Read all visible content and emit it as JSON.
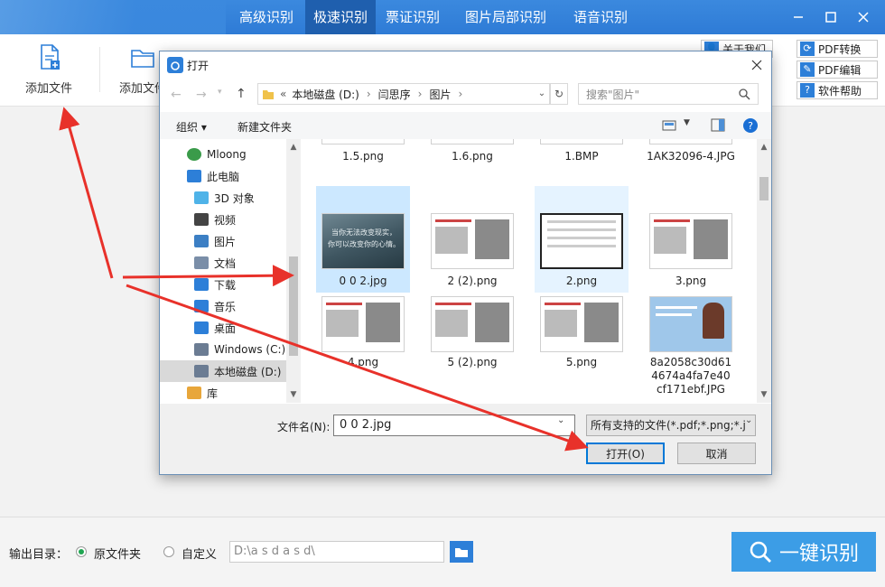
{
  "app": {
    "tabs": [
      "高级识别",
      "极速识别",
      "票证识别",
      "图片局部识别",
      "语音识别"
    ],
    "active_tab": "极速识别",
    "toolbar": {
      "add_file": "添加文件",
      "add_folder": "添加文件"
    },
    "side_buttons": {
      "about": "关于我们",
      "pdf_convert": "PDF转换",
      "pdf_edit": "PDF编辑",
      "help": "软件帮助"
    },
    "footer": {
      "output_label": "输出目录：",
      "option_original": "原文件夹",
      "option_custom": "自定义",
      "path_placeholder": "D:\\a s d a s d\\",
      "recognize_button": "一键识别"
    }
  },
  "dialog": {
    "title": "打开",
    "breadcrumb": [
      "本地磁盘 (D:)",
      "闫思序",
      "图片"
    ],
    "breadcrumb_prefix": "«",
    "search_placeholder": "搜索\"图片\"",
    "organize": "组织 ▾",
    "new_folder": "新建文件夹",
    "nav_items": [
      {
        "label": "Mloong",
        "icon": "user-icon"
      },
      {
        "label": "此电脑",
        "icon": "computer-icon"
      },
      {
        "label": "3D 对象",
        "icon": "cube-icon"
      },
      {
        "label": "视频",
        "icon": "video-icon"
      },
      {
        "label": "图片",
        "icon": "picture-icon"
      },
      {
        "label": "文档",
        "icon": "document-icon"
      },
      {
        "label": "下载",
        "icon": "download-icon"
      },
      {
        "label": "音乐",
        "icon": "music-icon"
      },
      {
        "label": "桌面",
        "icon": "desktop-icon"
      },
      {
        "label": "Windows (C:)",
        "icon": "drive-icon"
      },
      {
        "label": "本地磁盘 (D:)",
        "icon": "drive-icon"
      },
      {
        "label": "库",
        "icon": "library-icon"
      }
    ],
    "selected_nav": "本地磁盘 (D:)",
    "files_top_row": [
      "1.5.png",
      "1.6.png",
      "1.BMP",
      "1AK32096-4.JPG"
    ],
    "files": [
      {
        "name": "0 0 2.jpg",
        "state": "selected"
      },
      {
        "name": "2 (2).png",
        "state": "normal"
      },
      {
        "name": "2.png",
        "state": "hover"
      },
      {
        "name": "3.png",
        "state": "normal"
      },
      {
        "name": "4.png",
        "state": "normal"
      },
      {
        "name": "5 (2).png",
        "state": "normal"
      },
      {
        "name": "5.png",
        "state": "normal"
      },
      {
        "name": "8a2058c30d614674a4fa7e40cf171ebf.JPG",
        "state": "normal"
      }
    ],
    "thumb_text_1": "当你无法改变现实，",
    "thumb_text_2": "你可以改变你的心情。",
    "filename_label": "文件名(N):",
    "filename_value": "0 0 2.jpg",
    "filter_value": "所有支持的文件(*.pdf;*.png;*.j",
    "open_button": "打开(O)",
    "cancel_button": "取消"
  },
  "colors": {
    "titlebar": "#2e7bd6",
    "accent": "#3c9de6",
    "arrow": "#e8312a",
    "selection": "#cce8ff"
  }
}
